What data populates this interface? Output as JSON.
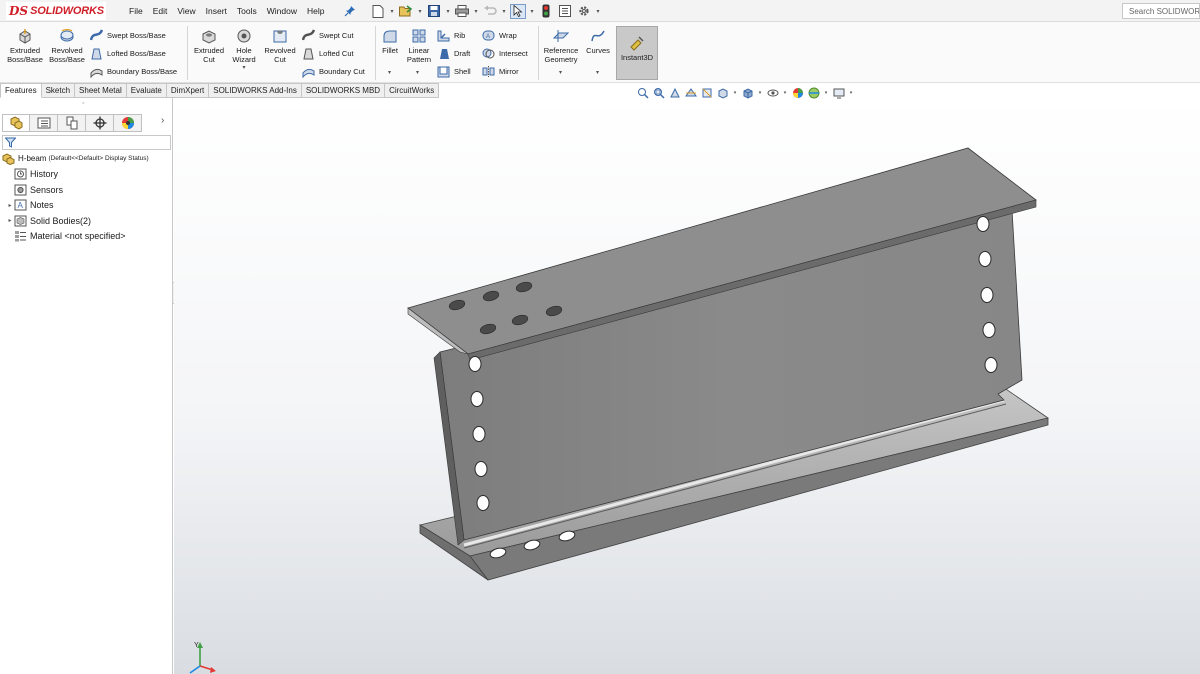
{
  "app": {
    "name": "SOLIDWORKS",
    "logo_ds": "DS"
  },
  "menu": [
    "File",
    "Edit",
    "View",
    "Insert",
    "Tools",
    "Window",
    "Help"
  ],
  "search": {
    "placeholder": "Search SOLIDWORKS"
  },
  "ribbon": {
    "extruded_boss": "Extruded Boss/Base",
    "revolved_boss": "Revolved Boss/Base",
    "swept_boss": "Swept Boss/Base",
    "lofted_boss": "Lofted Boss/Base",
    "boundary_boss": "Boundary Boss/Base",
    "extruded_cut": "Extruded Cut",
    "hole_wizard": "Hole Wizard",
    "revolved_cut": "Revolved Cut",
    "swept_cut": "Swept Cut",
    "lofted_cut": "Lofted Cut",
    "boundary_cut": "Boundary Cut",
    "fillet": "Fillet",
    "linear_pattern": "Linear Pattern",
    "rib": "Rib",
    "draft": "Draft",
    "shell": "Shell",
    "wrap": "Wrap",
    "intersect": "Intersect",
    "mirror": "Mirror",
    "reference_geometry": "Reference Geometry",
    "curves": "Curves",
    "instant3d": "Instant3D"
  },
  "tabs": [
    "Features",
    "Sketch",
    "Sheet Metal",
    "Evaluate",
    "DimXpert",
    "SOLIDWORKS Add-Ins",
    "SOLIDWORKS MBD",
    "CircuitWorks"
  ],
  "active_tab": "Features",
  "tree": {
    "root": {
      "name": "H-beam",
      "config": "(Default<<Default> Display Status)"
    },
    "items": [
      {
        "label": "History",
        "expandable": false
      },
      {
        "label": "Sensors",
        "expandable": false
      },
      {
        "label": "Notes",
        "expandable": true
      },
      {
        "label": "Solid Bodies(2)",
        "expandable": true
      },
      {
        "label": "Material <not specified>",
        "expandable": false
      }
    ]
  },
  "colors": {
    "brand_red": "#d0202a",
    "model_gray": "#8a8a8a",
    "background_top": "#ffffff",
    "background_bottom": "#d9dde2"
  },
  "icons": [
    "pin-icon",
    "new-document-icon",
    "open-icon",
    "save-icon",
    "print-icon",
    "undo-icon",
    "select-icon",
    "rebuild-icon",
    "file-properties-icon",
    "options-icon",
    "search-icon",
    "triad-icon"
  ]
}
